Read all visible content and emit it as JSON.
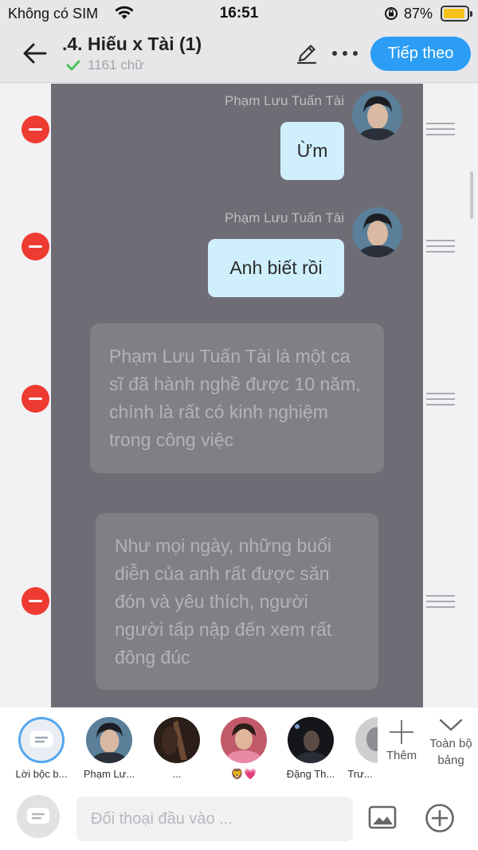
{
  "status_bar": {
    "carrier": "Không có SIM",
    "time": "16:51",
    "battery_percent": "87%",
    "battery_level": 0.87
  },
  "header": {
    "title": ".4. Hiếu x Tài (1)",
    "word_count": "1161 chữ",
    "next_label": "Tiếp theo"
  },
  "messages": [
    {
      "type": "dialogue",
      "speaker": "Phạm Lưu Tuấn Tài",
      "text": "Ừm"
    },
    {
      "type": "dialogue",
      "speaker": "Phạm Lưu Tuấn Tài",
      "text": "Anh biết rồi"
    },
    {
      "type": "narration",
      "text": "Phạm Lưu Tuấn Tài là một ca sĩ đã hành nghề được 10 năm, chính là rất có kinh nghiệm trong công việc"
    },
    {
      "type": "narration",
      "text": "Như mọi ngày, những buổi diễn của anh rất được săn đón và yêu thích, người người tấp nập đến xem rất đông đúc"
    }
  ],
  "characters": [
    {
      "label": "Lời bộc b..."
    },
    {
      "label": "Phạm Lư..."
    },
    {
      "label": "..."
    },
    {
      "label": "🦁💗"
    },
    {
      "label": "Đặng Th..."
    },
    {
      "label": "Trư..."
    }
  ],
  "charbar": {
    "add_label": "Thêm",
    "all_board_label": "Toàn bộ bảng"
  },
  "input": {
    "placeholder": "Đối thoại đầu vào ..."
  },
  "colors": {
    "accent": "#2b9df4",
    "delete": "#ee3b32",
    "bubble": "#cfeffc",
    "overlay": "#6e6d75"
  }
}
